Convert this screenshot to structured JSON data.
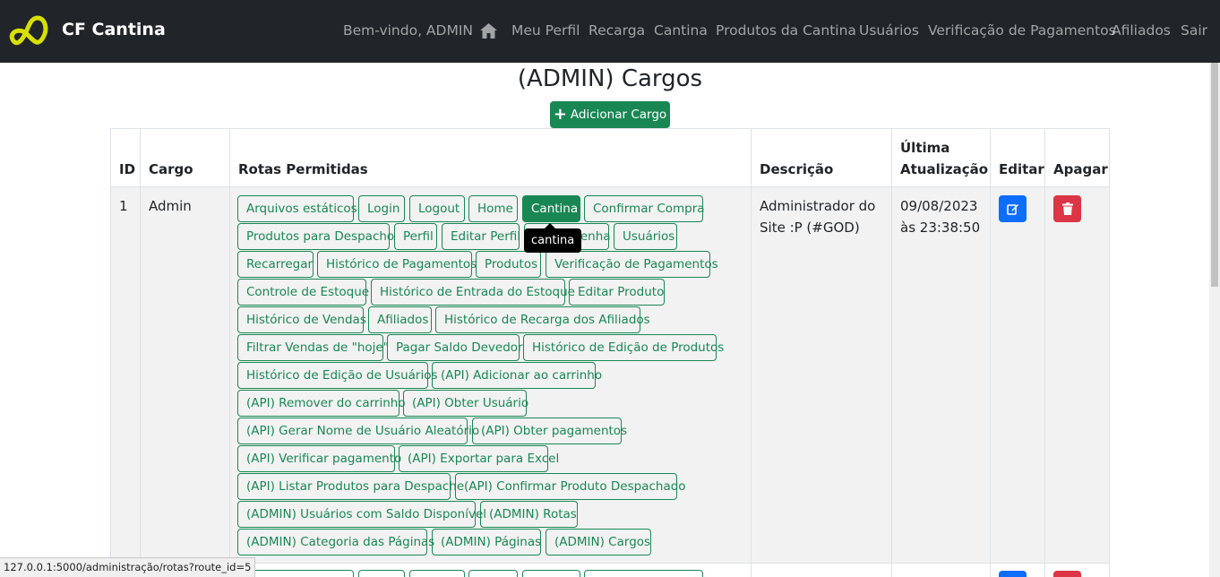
{
  "brand": {
    "name": "CF Cantina",
    "logo_icon": "infinity-logo-icon",
    "logo_color": "#d8e000"
  },
  "nav": {
    "welcome": "Bem-vindo, ADMIN",
    "home_icon": "home-icon",
    "items": [
      "Meu Perfil",
      "Recarga",
      "Cantina",
      "Produtos da Cantina",
      "Usuários",
      "Verificação de Pagamentos",
      "Afiliados",
      "Sair"
    ]
  },
  "page": {
    "title": "(ADMIN) Cargos",
    "add_button": "Adicionar Cargo"
  },
  "table": {
    "headers": {
      "id": "ID",
      "cargo": "Cargo",
      "rotas": "Rotas Permitidas",
      "descricao": "Descrição",
      "atualizacao_1": "Última",
      "atualizacao_2": "Atualização",
      "editar": "Editar",
      "apagar": "Apagar"
    },
    "rows": [
      {
        "id": "1",
        "cargo": "Admin",
        "descricao_1": "Administrador do",
        "descricao_2": "Site :P (#GOD)",
        "data_1": "09/08/2023",
        "data_2": "às 23:38:50",
        "routes": [
          "Arquivos estáticos",
          "Login",
          "Logout",
          "Home",
          "Cantina",
          "Confirmar Compra",
          "Produtos para Despacho",
          "Perfil",
          "Editar Perfil",
          "Editar Senha",
          "Usuários",
          "Recarregar",
          "Histórico de Pagamentos",
          "Produtos",
          "Verificação de Pagamentos",
          "Controle de Estoque",
          "Histórico de Entrada do Estoque",
          "Editar Produto",
          "Histórico de Vendas",
          "Afiliados",
          "Histórico de Recarga dos Afiliados",
          "Filtrar Vendas de \"hoje\"",
          "Pagar Saldo Devedor",
          "Histórico de Edição de Produtos",
          "Histórico de Edição de Usuários",
          "(API) Adicionar ao carrinho",
          "(API) Remover do carrinho",
          "(API) Obter Usuário",
          "(API) Gerar Nome de Usuário Aleatório",
          "(API) Obter pagamentos",
          "(API) Verificar pagamento",
          "(API) Exportar para Excel",
          "(API) Listar Produtos para Despache",
          "(API) Confirmar Produto Despachado",
          "(ADMIN) Usuários com Saldo Disponível",
          "(ADMIN) Rotas",
          "(ADMIN) Categoria das Páginas",
          "(ADMIN) Páginas",
          "(ADMIN) Cargos"
        ],
        "active_route": "Cantina",
        "tooltip": "cantina"
      }
    ]
  },
  "status_url": "127.0.0.1:5000/administração/rotas?route_id=5",
  "colors": {
    "navbar": "#212529",
    "success": "#198754",
    "primary": "#0d6efd",
    "danger": "#dc3545"
  }
}
